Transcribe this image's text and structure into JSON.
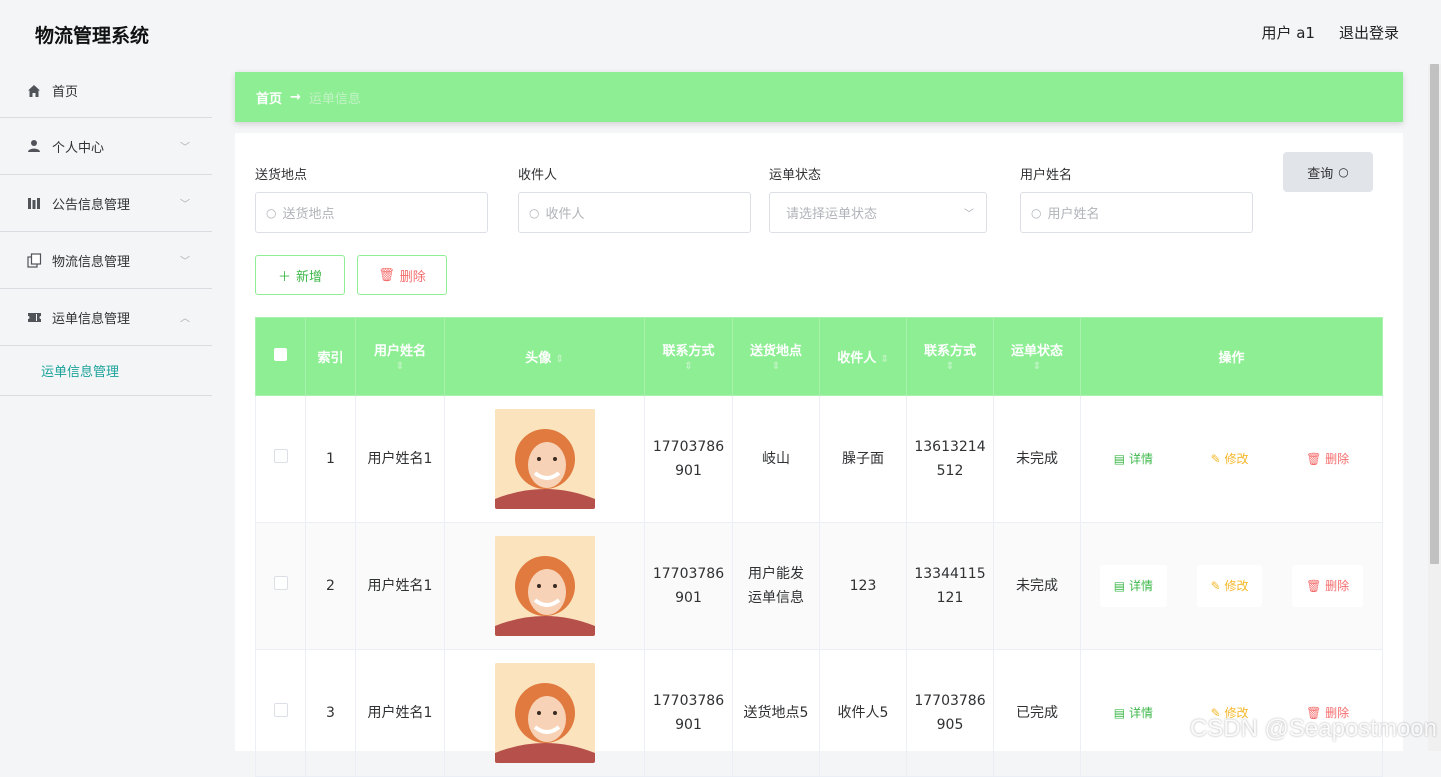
{
  "header": {
    "title": "物流管理系统",
    "user_label": "用户 a1",
    "logout_label": "退出登录"
  },
  "sidebar": {
    "items": [
      {
        "label": "首页",
        "icon": "home-icon"
      },
      {
        "label": "个人中心",
        "icon": "user-icon"
      },
      {
        "label": "公告信息管理",
        "icon": "bars-icon"
      },
      {
        "label": "物流信息管理",
        "icon": "copy-icon"
      },
      {
        "label": "运单信息管理",
        "icon": "ticket-icon"
      }
    ],
    "submenu_label": "运单信息管理"
  },
  "breadcrumb": {
    "home": "首页",
    "arrow": "→",
    "current": "运单信息"
  },
  "filters": {
    "address_label": "送货地点",
    "address_placeholder": "送货地点",
    "recipient_label": "收件人",
    "recipient_placeholder": "收件人",
    "status_label": "运单状态",
    "status_placeholder": "请选择运单状态",
    "username_label": "用户姓名",
    "username_placeholder": "用户姓名",
    "query_button": "查询"
  },
  "actions": {
    "add": "新增",
    "delete": "删除"
  },
  "table": {
    "headers": [
      "索引",
      "用户姓名",
      "头像",
      "联系方式",
      "送货地点",
      "收件人",
      "联系方式",
      "运单状态",
      "操作"
    ],
    "rows": [
      {
        "index": "1",
        "username": "用户姓名1",
        "phone_a": "17703786",
        "phone_b": "901",
        "address_a": "岐山",
        "address_b": "",
        "recipient": "臊子面",
        "rphone_a": "13613214",
        "rphone_b": "512",
        "status": "未完成"
      },
      {
        "index": "2",
        "username": "用户姓名1",
        "phone_a": "17703786",
        "phone_b": "901",
        "address_a": "用户能发",
        "address_b": "运单信息",
        "recipient": "123",
        "rphone_a": "13344115",
        "rphone_b": "121",
        "status": "未完成"
      },
      {
        "index": "3",
        "username": "用户姓名1",
        "phone_a": "17703786",
        "phone_b": "901",
        "address_a": "送货地点5",
        "address_b": "",
        "recipient": "收件人5",
        "rphone_a": "17703786",
        "rphone_b": "905",
        "status": "已完成"
      }
    ],
    "op_detail": "详情",
    "op_edit": "修改",
    "op_delete": "删除"
  },
  "watermark": "CSDN @Seapostmoon",
  "colors": {
    "accent": "#8eee94",
    "teal": "#1aa39a",
    "danger": "#f56c6c",
    "warning": "#f5b82a",
    "success": "#3fb84b"
  }
}
